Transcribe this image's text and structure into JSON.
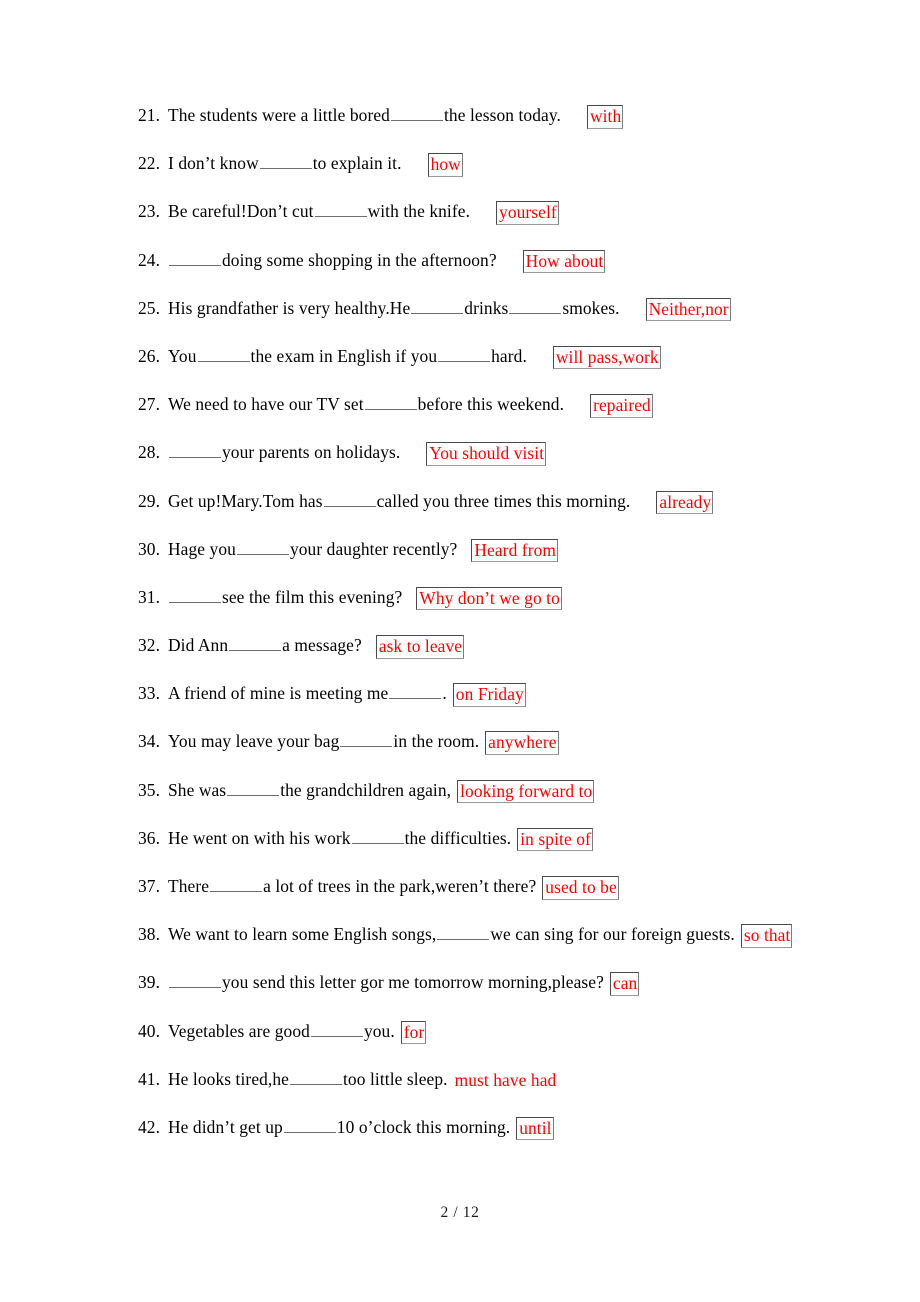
{
  "document": {
    "type": "grammar-fill-in-the-blank-worksheet",
    "page_label": "2 / 12",
    "page_current": "2",
    "page_total": "12",
    "answer_color": "#ff0000",
    "text_color": "#000000"
  },
  "exercises": [
    {
      "number": "21.",
      "before": "The students were a little bored",
      "after": "the lesson today.",
      "answer": "with",
      "boxed": true,
      "gap_before_answer": "large"
    },
    {
      "number": "22.",
      "before": "I don’t know",
      "after": "to explain it.",
      "answer": "how",
      "boxed": true,
      "gap_before_answer": "large"
    },
    {
      "number": "23.",
      "before": "Be careful!Don’t cut",
      "after": "with the knife.",
      "answer": "yourself",
      "boxed": true,
      "gap_before_answer": "large"
    },
    {
      "number": "24.",
      "before": "",
      "after": "doing some shopping in the afternoon?",
      "answer": "How about",
      "boxed": true,
      "gap_before_answer": "large"
    },
    {
      "number": "25.",
      "before": "His grandfather is very healthy.He",
      "middle": "drinks",
      "after": "smokes.",
      "answer": "Neither,nor",
      "boxed": true,
      "two_blanks": true,
      "gap_before_answer": "large"
    },
    {
      "number": "26.",
      "before": "You",
      "middle": "the exam in English if you",
      "after": "hard.",
      "answer": "will pass,work",
      "boxed": true,
      "two_blanks": true,
      "gap_before_answer": "large"
    },
    {
      "number": "27.",
      "before": "We need to have our TV set",
      "after": "before this weekend.",
      "answer": "repaired",
      "boxed": true,
      "gap_before_answer": "large"
    },
    {
      "number": "28.",
      "before": "",
      "after": "your parents on holidays.",
      "answer": "You should visit",
      "boxed": true,
      "gap_before_answer": "large"
    },
    {
      "number": "29.",
      "before": "Get up!Mary.Tom has",
      "after": "called you three times this morning.",
      "answer": "already",
      "boxed": true,
      "gap_before_answer": "large"
    },
    {
      "number": "30.",
      "before": "Hage you",
      "after": "your daughter recently?",
      "answer": "Heard from",
      "boxed": true,
      "gap_before_answer": "medium"
    },
    {
      "number": "31.",
      "before": "",
      "after": "see the film this evening?",
      "answer": "Why don’t we go to",
      "boxed": true,
      "gap_before_answer": "medium"
    },
    {
      "number": "32.",
      "before": "Did Ann",
      "after": "a message?",
      "answer": "ask to leave",
      "boxed": true,
      "gap_before_answer": "medium"
    },
    {
      "number": "33.",
      "before": "A friend of mine is meeting me",
      "after": ".",
      "answer": "on Friday",
      "boxed": true,
      "gap_before_answer": "small"
    },
    {
      "number": "34.",
      "before": "You may leave your bag",
      "after": "in the room.",
      "answer": "anywhere",
      "boxed": true,
      "gap_before_answer": "small",
      "no_space_after_blank": true
    },
    {
      "number": "35.",
      "before": "She was",
      "after": "the grandchildren again,",
      "answer": "looking forward to",
      "boxed": true,
      "gap_before_answer": "small"
    },
    {
      "number": "36.",
      "before": "He went on with his work",
      "after": "the difficulties.",
      "answer": "in spite of",
      "boxed": true,
      "gap_before_answer": "small",
      "no_space_after_blank": true
    },
    {
      "number": "37.",
      "before": "There",
      "after": "a lot of trees in the park,weren’t there?",
      "answer": "used to be",
      "boxed": true,
      "gap_before_answer": "small",
      "no_space_after_blank": true
    },
    {
      "number": "38.",
      "before": "We want to learn some English songs,",
      "after": "we can sing for our foreign guests.",
      "answer": "so that",
      "boxed": true,
      "gap_before_answer": "small",
      "no_space_after_blank": true
    },
    {
      "number": "39.",
      "before": "",
      "after": "you send this letter gor me tomorrow morning,please?",
      "answer": "can",
      "boxed": true,
      "gap_before_answer": "small"
    },
    {
      "number": "40.",
      "before": "Vegetables are good",
      "after": "you.",
      "answer": "for",
      "boxed": true,
      "gap_before_answer": "small"
    },
    {
      "number": "41.",
      "before": "He looks tired,he",
      "after": "too little sleep.",
      "answer": "must have had",
      "boxed": false,
      "gap_before_answer": "small"
    },
    {
      "number": "42.",
      "before": "He didn’t get up",
      "after": "10 o’clock this morning.",
      "answer": "until",
      "boxed": true,
      "gap_before_answer": "small"
    }
  ]
}
